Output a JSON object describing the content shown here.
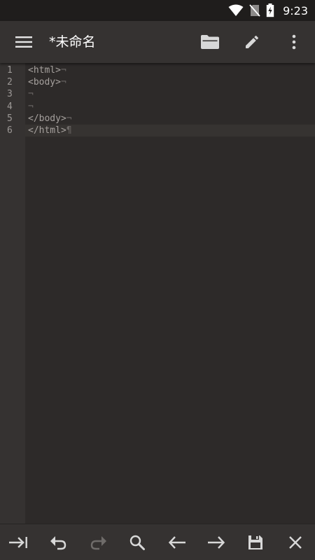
{
  "status_bar": {
    "time": "9:23",
    "icons": [
      "wifi-icon",
      "no-sim-icon",
      "battery-charging-icon"
    ]
  },
  "app_bar": {
    "title": "*未命名",
    "icons": [
      "menu-icon",
      "folder-open-icon",
      "edit-pencil-icon",
      "more-vert-icon"
    ]
  },
  "editor": {
    "lines": [
      {
        "number": "1",
        "text": "<html>",
        "end_marker": "¬"
      },
      {
        "number": "2",
        "text": "<body>",
        "end_marker": "¬"
      },
      {
        "number": "3",
        "text": "",
        "end_marker": "¬"
      },
      {
        "number": "4",
        "text": "",
        "end_marker": "¬"
      },
      {
        "number": "5",
        "text": "</body>",
        "end_marker": "¬"
      },
      {
        "number": "6",
        "text": "</html>",
        "end_marker": "¶"
      }
    ],
    "current_line": "6"
  },
  "bottom_bar": {
    "icons": [
      "tab-indent-icon",
      "undo-icon",
      "redo-icon",
      "search-icon",
      "arrow-left-icon",
      "arrow-right-icon",
      "save-icon",
      "close-icon"
    ]
  },
  "colors": {
    "background": "#2d2a29",
    "toolbar": "#353231",
    "statusbar": "#1f1d1c",
    "code_text": "#a6a19e",
    "line_number": "#9c9896"
  }
}
